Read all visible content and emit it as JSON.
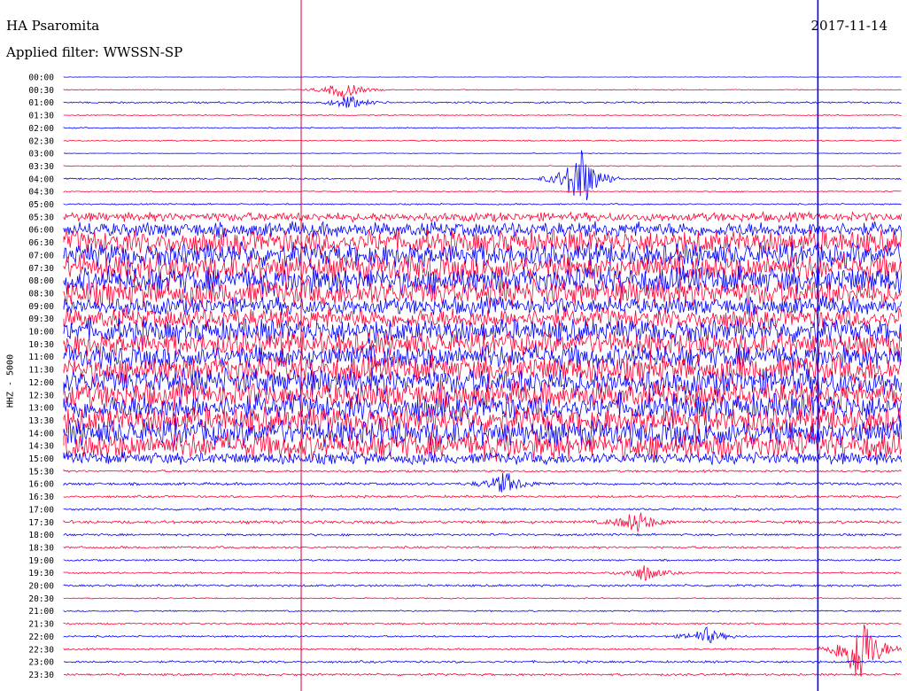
{
  "header": {
    "station": "HA Psaromita",
    "filter": "Applied filter: WWSSN-SP",
    "date": "2017-11-14"
  },
  "chart_data": {
    "type": "line",
    "title": "HA Psaromita",
    "subtitle": "Applied filter: WWSSN-SP",
    "ylabel": "HHZ - 5000",
    "xlabel": "",
    "grid": false,
    "colors": {
      "even_rows": "#0000ff",
      "odd_rows": "#ff0033",
      "markers": "#0000ff",
      "markers_alt": "#cc0033"
    },
    "row_labels": [
      "00:00",
      "00:30",
      "01:00",
      "01:30",
      "02:00",
      "02:30",
      "03:00",
      "03:30",
      "04:00",
      "04:30",
      "05:00",
      "05:30",
      "06:00",
      "06:30",
      "07:00",
      "07:30",
      "08:00",
      "08:30",
      "09:00",
      "09:30",
      "10:00",
      "10:30",
      "11:00",
      "11:30",
      "12:00",
      "12:30",
      "13:00",
      "13:30",
      "14:00",
      "14:30",
      "15:00",
      "15:30",
      "16:00",
      "16:30",
      "17:00",
      "17:30",
      "18:00",
      "18:30",
      "19:00",
      "19:30",
      "20:00",
      "20:30",
      "21:00",
      "21:30",
      "22:00",
      "22:30",
      "23:00",
      "23:30"
    ],
    "row_amplitude": [
      0.3,
      0.6,
      1.2,
      0.7,
      0.8,
      0.8,
      0.4,
      0.7,
      1.0,
      0.8,
      1.0,
      6,
      10,
      16,
      16,
      18,
      18,
      18,
      12,
      14,
      16,
      16,
      16,
      18,
      18,
      18,
      18,
      18,
      18,
      18,
      8,
      1.5,
      1.8,
      1.5,
      1.5,
      2.0,
      1.5,
      1.5,
      1.2,
      1.2,
      1.5,
      0.8,
      1.0,
      1.2,
      1.2,
      1.2,
      1.5,
      1.5
    ],
    "events": [
      {
        "row": 1,
        "minute": 10.0,
        "amplitude": 12
      },
      {
        "row": 2,
        "minute": 10.2,
        "amplitude": 8
      },
      {
        "row": 8,
        "minute": 18.5,
        "amplitude": 40
      },
      {
        "row": 32,
        "minute": 15.8,
        "amplitude": 14
      },
      {
        "row": 35,
        "minute": 20.5,
        "amplitude": 14
      },
      {
        "row": 39,
        "minute": 20.8,
        "amplitude": 10
      },
      {
        "row": 44,
        "minute": 23.0,
        "amplitude": 10
      },
      {
        "row": 45,
        "minute": 28.5,
        "amplitude": 50
      }
    ],
    "marker_minutes": [
      8.5,
      27.0,
      31.0
    ]
  }
}
